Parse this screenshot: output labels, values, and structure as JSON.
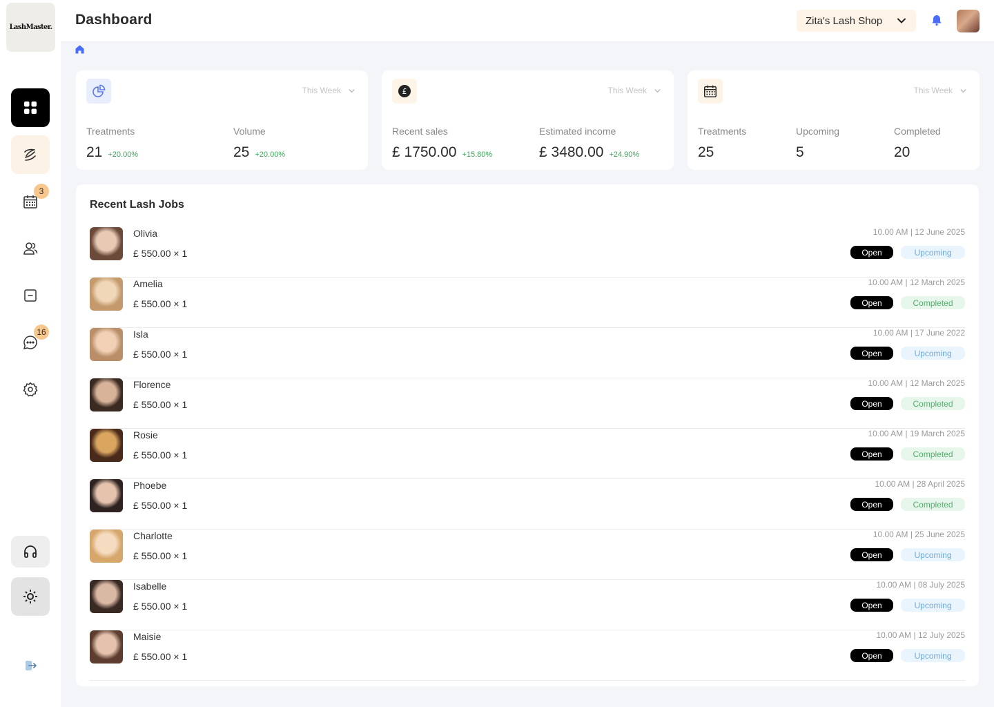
{
  "brand": {
    "logo": "LashMaster."
  },
  "header": {
    "title": "Dashboard",
    "shop": "Zita's Lash Shop"
  },
  "sidebar": {
    "items": [
      {
        "name": "dashboard",
        "icon": "grid-icon",
        "active": true
      },
      {
        "name": "treatments",
        "icon": "lash-icon"
      },
      {
        "name": "calendar",
        "icon": "calendar-icon",
        "badge": "3"
      },
      {
        "name": "clients",
        "icon": "users-icon"
      },
      {
        "name": "folder",
        "icon": "folder-icon"
      },
      {
        "name": "messages",
        "icon": "chat-icon",
        "badge": "16"
      },
      {
        "name": "settings",
        "icon": "gear-icon"
      },
      {
        "name": "support",
        "icon": "headphones-icon"
      },
      {
        "name": "admin-settings",
        "icon": "cog-icon"
      },
      {
        "name": "logout",
        "icon": "logout-icon"
      }
    ]
  },
  "cards": [
    {
      "icon": "pie-chart-icon",
      "period": "This Week",
      "metrics": [
        {
          "label": "Treatments",
          "value": "21",
          "change": "+20.00%"
        },
        {
          "label": "Volume",
          "value": "25",
          "change": "+20.00%"
        }
      ]
    },
    {
      "icon": "pound-icon",
      "period": "This Week",
      "metrics": [
        {
          "label": "Recent sales",
          "value": "£ 1750.00",
          "change": "+15.80%"
        },
        {
          "label": "Estimated income",
          "value": "£ 3480.00",
          "change": "+24.90%"
        }
      ]
    },
    {
      "icon": "calendar-icon",
      "period": "This Week",
      "metrics": [
        {
          "label": "Treatments",
          "value": "25"
        },
        {
          "label": "Upcoming",
          "value": "5"
        },
        {
          "label": "Completed",
          "value": "20"
        }
      ]
    }
  ],
  "jobs": {
    "title": "Recent Lash Jobs",
    "open_label": "Open",
    "rows": [
      {
        "name": "Olivia",
        "price": "£ 550.00 × 1",
        "when": "10.00 AM | 12 June 2025",
        "status": "Upcoming"
      },
      {
        "name": "Amelia",
        "price": "£ 550.00 × 1",
        "when": "10.00 AM | 12 March 2025",
        "status": "Completed"
      },
      {
        "name": "Isla",
        "price": "£ 550.00 × 1",
        "when": "10.00 AM | 17 June 2022",
        "status": "Upcoming"
      },
      {
        "name": "Florence",
        "price": "£ 550.00 × 1",
        "when": "10.00 AM | 12 March 2025",
        "status": "Completed"
      },
      {
        "name": "Rosie",
        "price": "£ 550.00 × 1",
        "when": "10.00 AM | 19 March 2025",
        "status": "Completed"
      },
      {
        "name": "Phoebe",
        "price": "£ 550.00 × 1",
        "when": "10.00 AM | 28 April 2025",
        "status": "Completed"
      },
      {
        "name": "Charlotte",
        "price": "£ 550.00 × 1",
        "when": "10.00 AM | 25 June 2025",
        "status": "Upcoming"
      },
      {
        "name": "Isabelle",
        "price": "£ 550.00 × 1",
        "when": "10.00 AM | 08 July 2025",
        "status": "Upcoming"
      },
      {
        "name": "Maisie",
        "price": "£ 550.00 × 1",
        "when": "10.00 AM | 12 July 2025",
        "status": "Upcoming"
      }
    ]
  },
  "colors": {
    "accent_peach": "#fdf3e7",
    "badge": "#f8c78e",
    "upcoming_bg": "#eaf4fd",
    "completed_bg": "#e6f6ea",
    "positive": "#3aa65a",
    "bell": "#4a6cf7"
  }
}
